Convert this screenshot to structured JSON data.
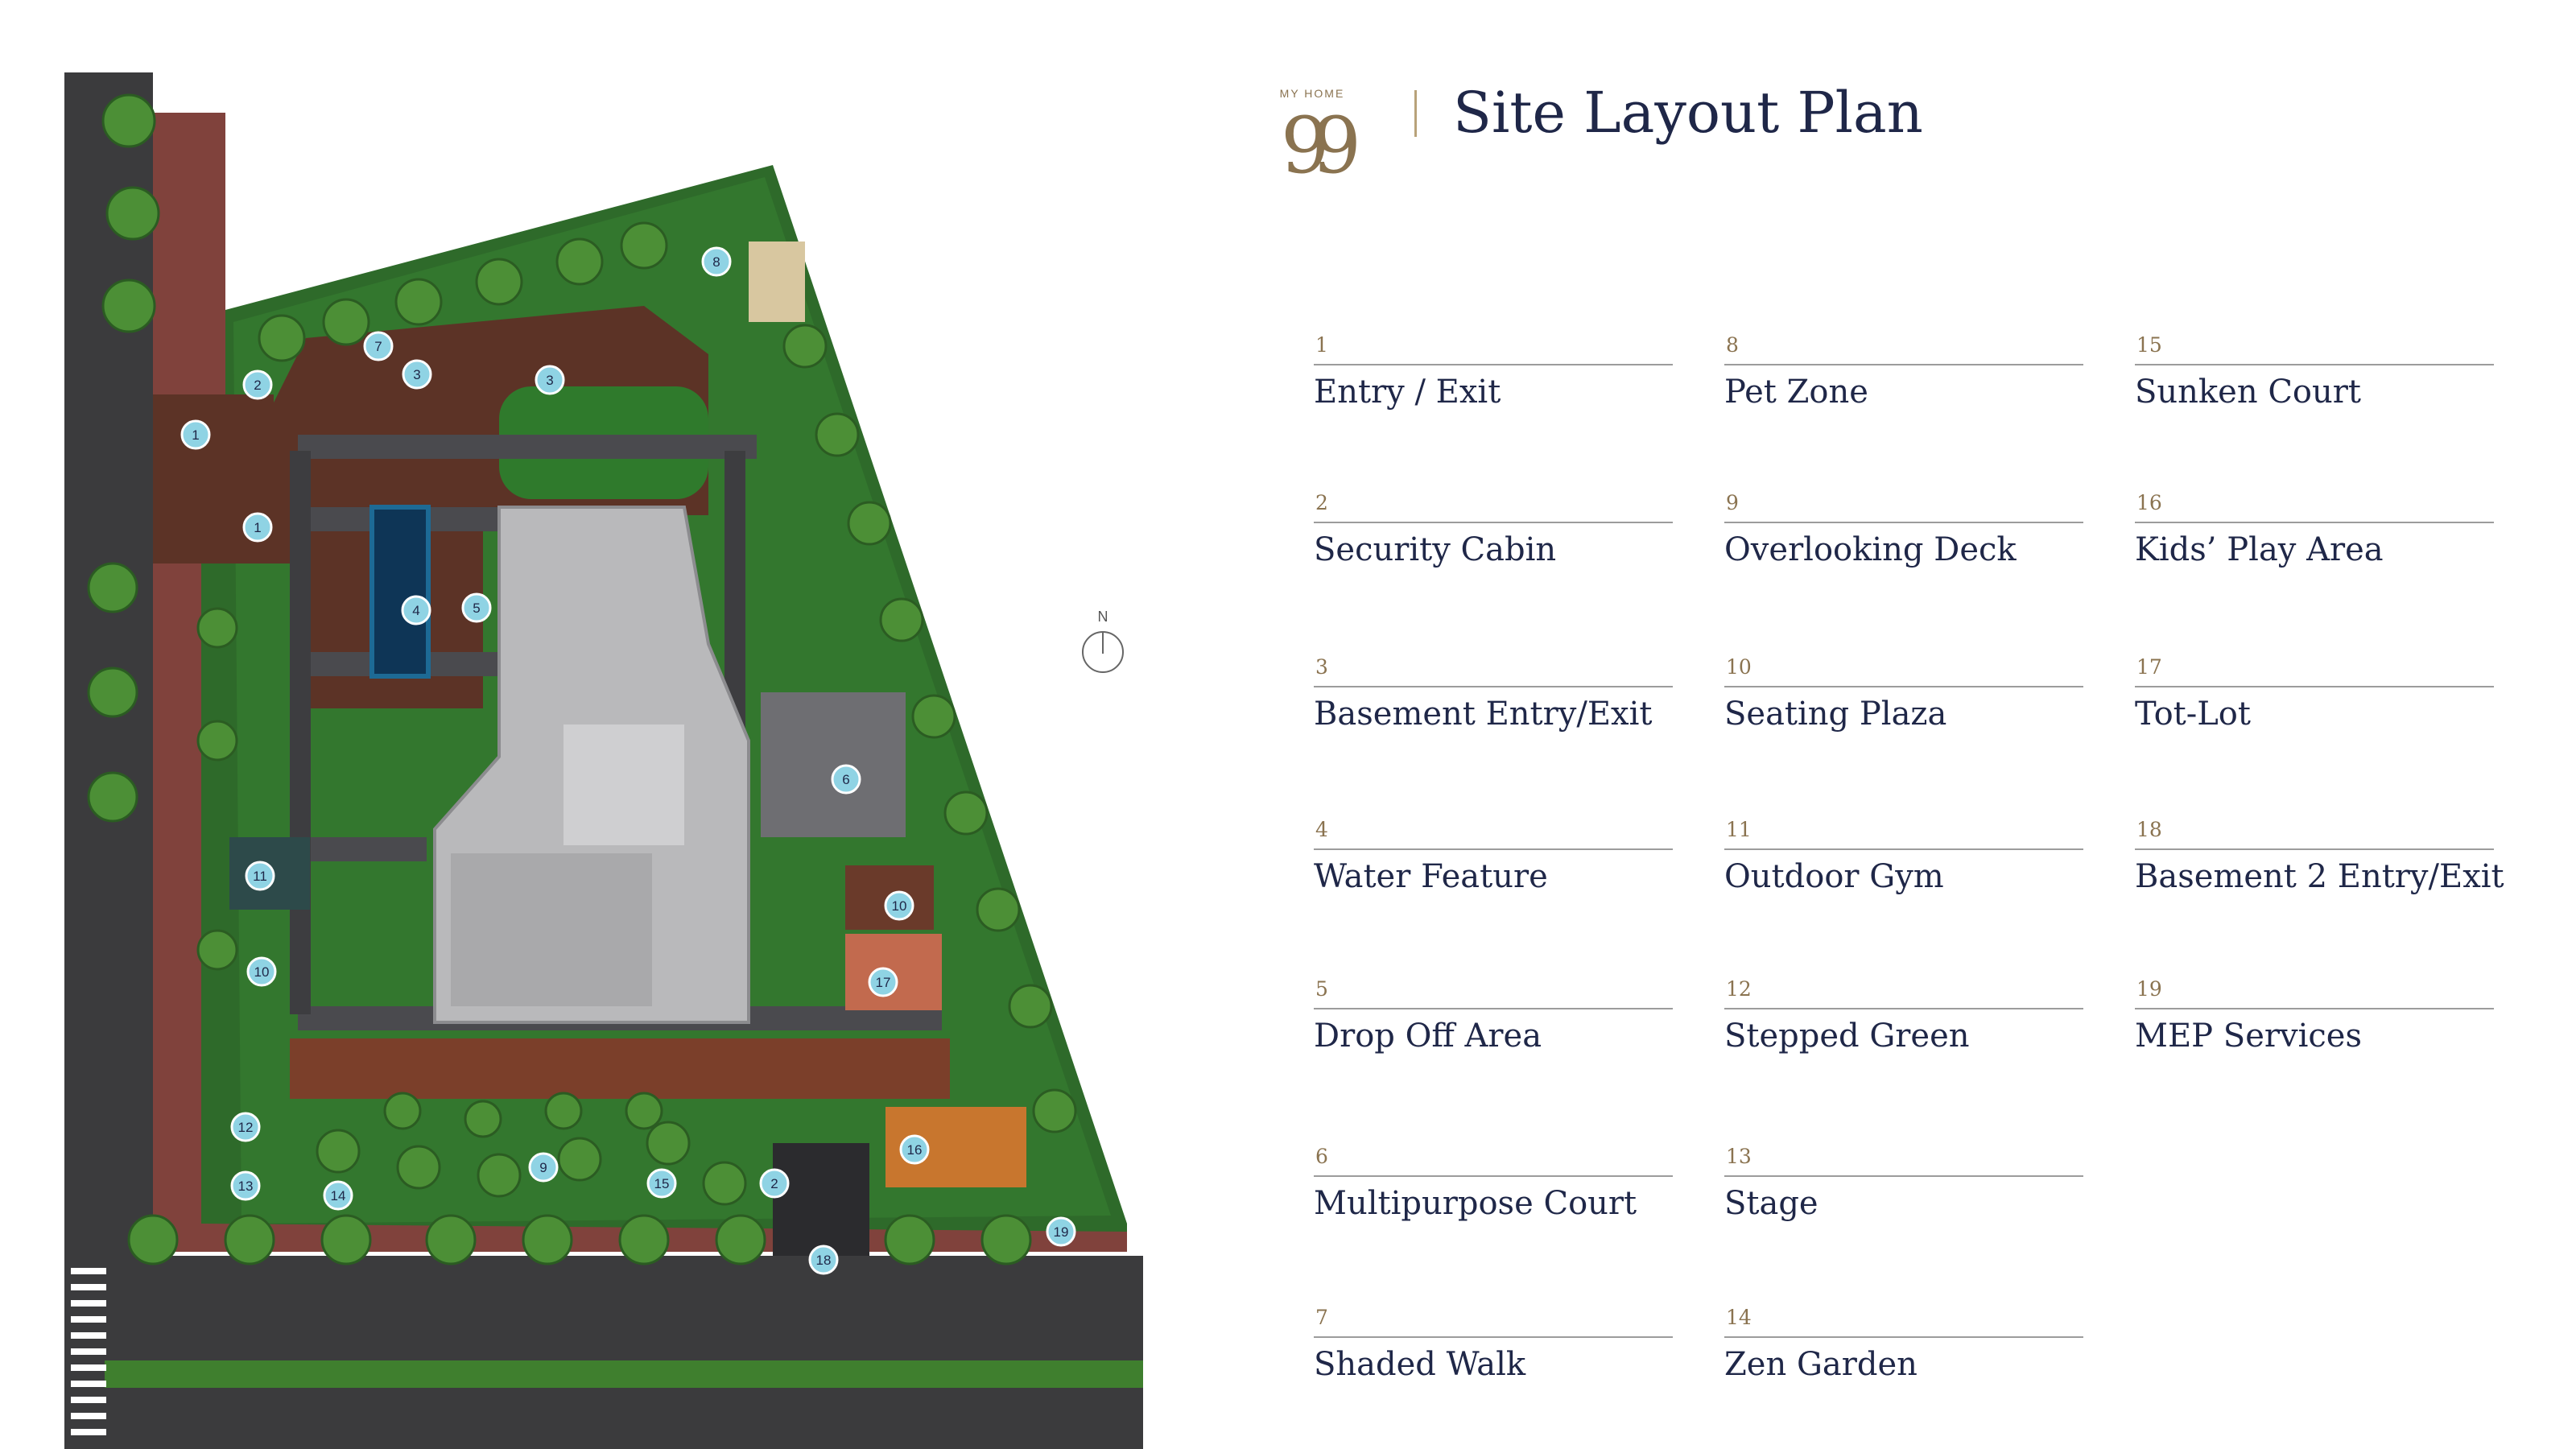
{
  "title": "Site Layout Plan",
  "brand": {
    "top": "MY HOME",
    "number": "99"
  },
  "north_label": "N",
  "colors": {
    "navy": "#1f2748",
    "gold": "#8a7350",
    "marker": "#8fd3e4",
    "lawn": "#2f7a2c",
    "paving": "#5c3326",
    "road": "#3b3b3d"
  },
  "legend": [
    {
      "num": "1",
      "label": "Entry / Exit"
    },
    {
      "num": "2",
      "label": "Security Cabin"
    },
    {
      "num": "3",
      "label": "Basement Entry/Exit"
    },
    {
      "num": "4",
      "label": "Water Feature"
    },
    {
      "num": "5",
      "label": "Drop Off Area"
    },
    {
      "num": "6",
      "label": "Multipurpose Court"
    },
    {
      "num": "7",
      "label": "Shaded Walk"
    },
    {
      "num": "8",
      "label": "Pet Zone"
    },
    {
      "num": "9",
      "label": "Overlooking Deck"
    },
    {
      "num": "10",
      "label": "Seating Plaza"
    },
    {
      "num": "11",
      "label": "Outdoor Gym"
    },
    {
      "num": "12",
      "label": "Stepped Green"
    },
    {
      "num": "13",
      "label": "Stage"
    },
    {
      "num": "14",
      "label": "Zen Garden"
    },
    {
      "num": "15",
      "label": "Sunken Court"
    },
    {
      "num": "16",
      "label": "Kids’ Play Area"
    },
    {
      "num": "17",
      "label": "Tot-Lot"
    },
    {
      "num": "18",
      "label": "Basement 2 Entry/Exit"
    },
    {
      "num": "19",
      "label": "MEP Services"
    }
  ],
  "markers": [
    "1",
    "1",
    "2",
    "2",
    "3",
    "3",
    "4",
    "5",
    "6",
    "7",
    "8",
    "9",
    "10",
    "10",
    "11",
    "12",
    "13",
    "14",
    "15",
    "16",
    "17",
    "18",
    "19"
  ]
}
